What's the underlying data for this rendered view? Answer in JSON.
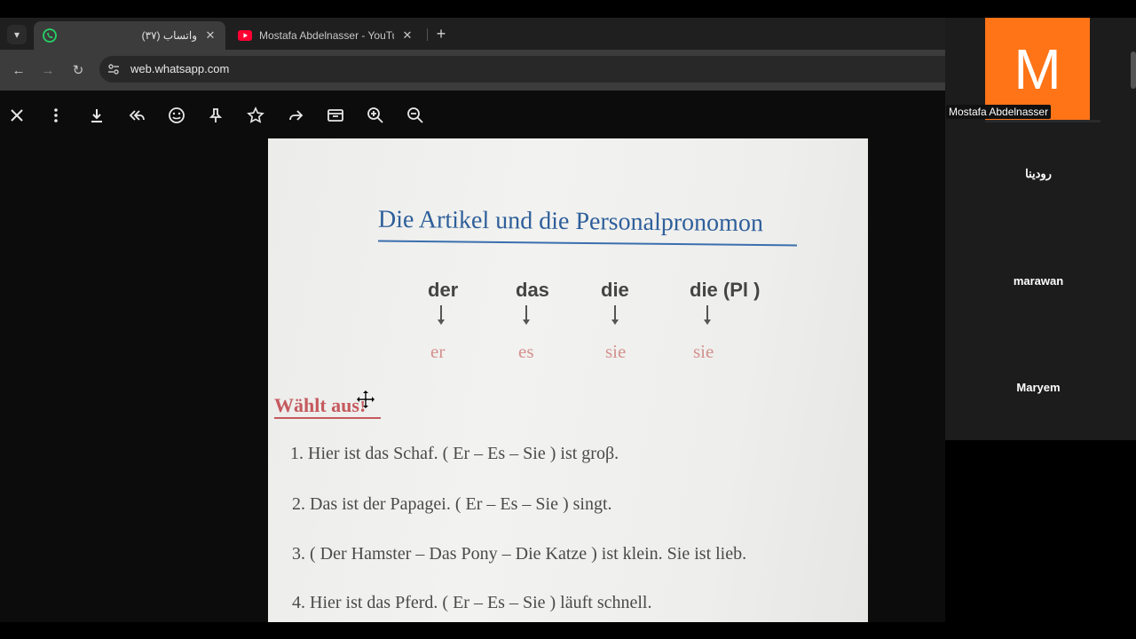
{
  "browser": {
    "tabs": [
      {
        "title": "واتساب (٣٧)",
        "active": true,
        "icon": "whatsapp-icon"
      },
      {
        "title": "Mostafa Abdelnasser - YouTube",
        "active": false,
        "icon": "youtube-icon"
      }
    ],
    "tab_dropdown_icon": "chevron-down-icon",
    "new_tab_label": "+",
    "close_glyph": "✕",
    "url": "web.whatsapp.com",
    "nav": {
      "back": "←",
      "forward": "→",
      "reload": "↻"
    }
  },
  "viewer_toolbar": {
    "icons": [
      "close-icon",
      "menu-icon",
      "download-icon",
      "reply-all-icon",
      "emoji-icon",
      "pin-icon",
      "star-icon",
      "forward-icon",
      "archive-icon",
      "zoom-in-icon",
      "zoom-out-icon"
    ]
  },
  "document": {
    "title": "Die Artikel und die Personalpronomon",
    "articles": [
      {
        "article": "der",
        "pronoun": "er"
      },
      {
        "article": "das",
        "pronoun": "es"
      },
      {
        "article": "die",
        "pronoun": "sie"
      },
      {
        "article": "die (Pl )",
        "pronoun": "sie"
      }
    ],
    "task_heading": "Wählt aus!",
    "sentences": [
      "1. Hier ist das Schaf. ( Er – Es – Sie ) ist groβ.",
      "2. Das ist der Papagei. ( Er – Es – Sie ) singt.",
      "3. ( Der Hamster – Das Pony – Die Katze ) ist klein. Sie ist lieb.",
      "4. Hier ist das Pferd. ( Er – Es – Sie ) läuft schnell."
    ]
  },
  "meeting": {
    "host": {
      "initial": "M",
      "name": "Mostafa Abdelnasser",
      "color": "#ff7417"
    },
    "participants": [
      "رودينا",
      "marawan",
      "Maryem"
    ]
  }
}
